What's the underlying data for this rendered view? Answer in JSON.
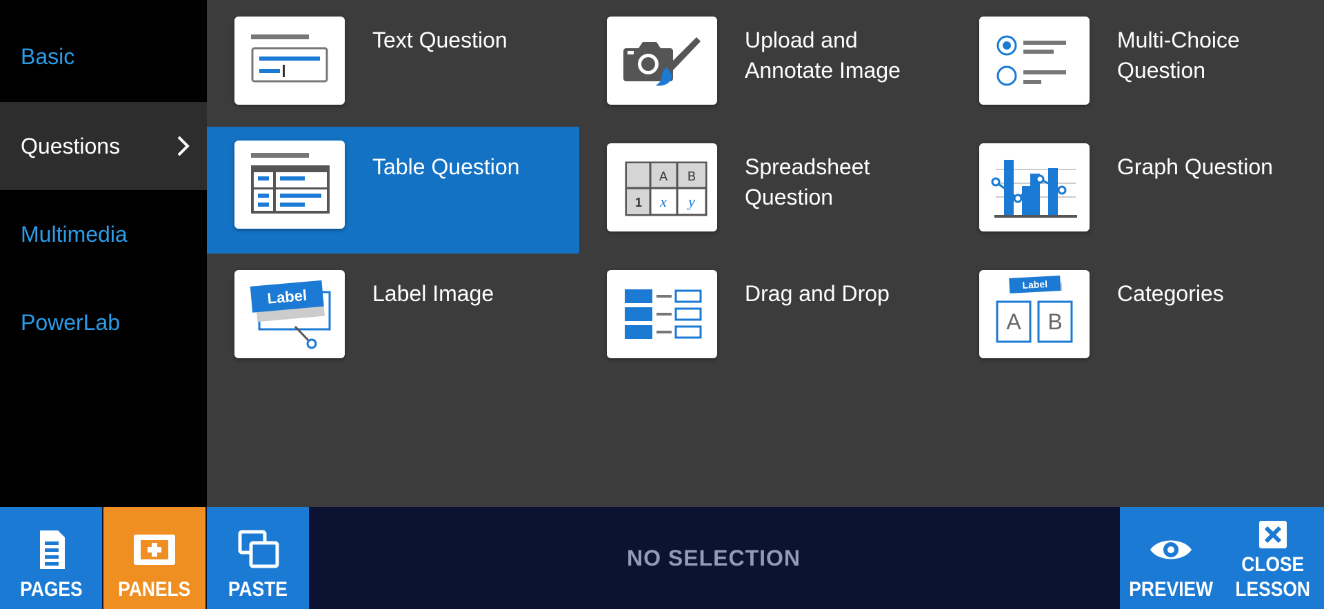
{
  "sidebar": {
    "items": [
      {
        "label": "Basic"
      },
      {
        "label": "Questions"
      },
      {
        "label": "Multimedia"
      },
      {
        "label": "PowerLab"
      }
    ],
    "active": "Questions",
    "icons": {
      "active_indicator": "chevron-right-icon"
    }
  },
  "panels": [
    {
      "label": "Text Question",
      "icon": "text-question-icon"
    },
    {
      "label": "Upload and Annotate Image",
      "icon": "camera-brush-icon"
    },
    {
      "label": "Multi-Choice Question",
      "icon": "multi-choice-icon"
    },
    {
      "label": "Table Question",
      "icon": "table-question-icon"
    },
    {
      "label": "Spreadsheet Question",
      "icon": "spreadsheet-icon",
      "cells": {
        "col_a": "A",
        "col_b": "B",
        "row_1": "1",
        "x": "x",
        "y": "y"
      }
    },
    {
      "label": "Graph Question",
      "icon": "graph-icon"
    },
    {
      "label": "Label Image",
      "icon": "label-image-icon",
      "tag": "Label"
    },
    {
      "label": "Drag and Drop",
      "icon": "drag-drop-icon"
    },
    {
      "label": "Categories",
      "icon": "categories-icon",
      "tag": "Label",
      "box_a": "A",
      "box_b": "B"
    }
  ],
  "selected_panel": "Table Question",
  "toolbar": {
    "pages": "PAGES",
    "panels": "PANELS",
    "paste": "PASTE",
    "status": "NO SELECTION",
    "preview": "PREVIEW",
    "close_line1": "CLOSE",
    "close_line2": "LESSON"
  },
  "colors": {
    "accent_blue": "#1a7ad4",
    "selected_tile": "#1472c4",
    "panels_orange": "#ef8f22",
    "sidebar_link": "#2b9de8",
    "bottom_bar": "#0c1332",
    "background": "#3c3c3c"
  }
}
